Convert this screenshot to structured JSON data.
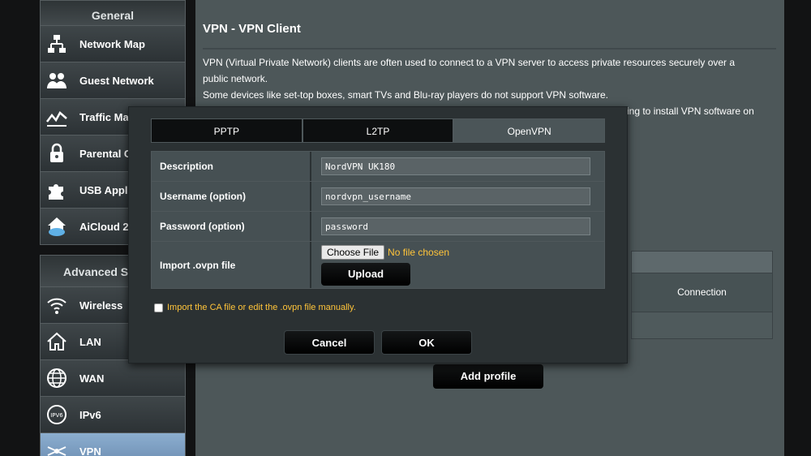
{
  "sidebar": {
    "general_title": "General",
    "general_items": [
      {
        "label": "Network Map",
        "icon": "network-map-icon"
      },
      {
        "label": "Guest Network",
        "icon": "guest-network-icon"
      },
      {
        "label": "Traffic Ma",
        "icon": "traffic-manager-icon"
      },
      {
        "label": "Parental C",
        "icon": "parental-control-icon"
      },
      {
        "label": "USB Appl",
        "icon": "usb-application-icon"
      },
      {
        "label": "AiCloud 2",
        "icon": "aicloud-icon"
      }
    ],
    "advanced_title": "Advanced S",
    "advanced_items": [
      {
        "label": "Wireless",
        "icon": "wireless-icon"
      },
      {
        "label": "LAN",
        "icon": "lan-icon"
      },
      {
        "label": "WAN",
        "icon": "wan-icon"
      },
      {
        "label": "IPv6",
        "icon": "ipv6-icon"
      },
      {
        "label": "VPN",
        "icon": "vpn-icon",
        "active": true
      }
    ]
  },
  "main": {
    "title": "VPN - VPN Client",
    "description": [
      "VPN (Virtual Private Network) clients are often used to connect to a VPN server to access private resources securely over a",
      "public network.",
      "Some devices like set-top boxes, smart TVs and Blu-ray players do not support VPN software.",
      "ing to install VPN software on"
    ],
    "connection_header": "Connection",
    "add_profile_label": "Add profile"
  },
  "dialog": {
    "tabs": [
      {
        "label": "PPTP",
        "selected": false
      },
      {
        "label": "L2TP",
        "selected": false
      },
      {
        "label": "OpenVPN",
        "selected": true
      }
    ],
    "description_label": "Description",
    "description_value": "NordVPN UK180",
    "username_label": "Username (option)",
    "username_value": "nordvpn_username",
    "password_label": "Password (option)",
    "password_value": "password",
    "import_label": "Import .ovpn file",
    "choose_file_label": "Choose File",
    "no_file_text": "No file chosen",
    "upload_label": "Upload",
    "manual_label": "Import the CA file or edit the .ovpn file manually.",
    "cancel_label": "Cancel",
    "ok_label": "OK"
  },
  "colors": {
    "accent": "#ffc43a",
    "active_menu": "#7a9cc0"
  }
}
